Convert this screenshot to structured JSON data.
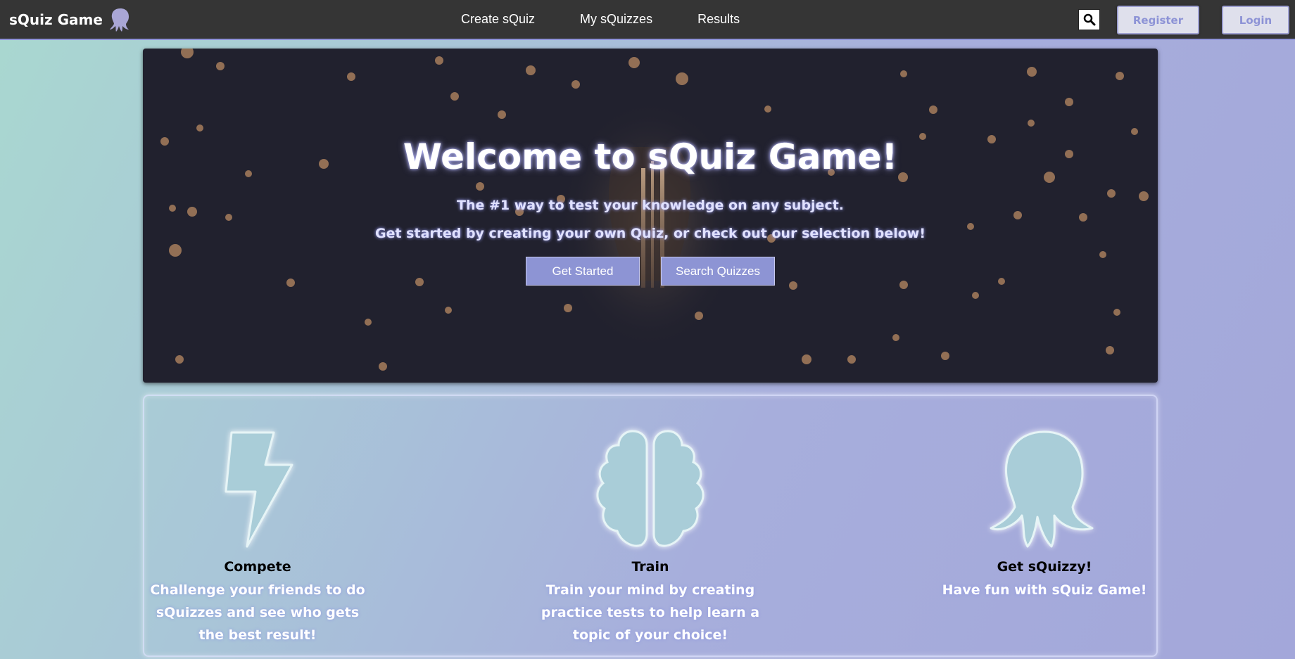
{
  "navbar": {
    "brand": "sQuiz Game",
    "links": [
      "Create sQuiz",
      "My sQuizzes",
      "Results"
    ],
    "register": "Register",
    "login": "Login"
  },
  "hero": {
    "title": "Welcome to sQuiz Game!",
    "subtitle1": "The #1 way to test your knowledge on any subject.",
    "subtitle2": "Get started by creating your own Quiz, or check out our selection below!",
    "get_started": "Get Started",
    "search_quizzes": "Search Quizzes"
  },
  "features": [
    {
      "icon": "lightning-icon",
      "title": "Compete",
      "desc": "Challenge your friends to do sQuizzes and see who gets the best result!"
    },
    {
      "icon": "brain-icon",
      "title": "Train",
      "desc": "Train your mind by creating practice tests to help learn a topic of your choice!"
    },
    {
      "icon": "octopus-icon",
      "title": "Get sQuizzy!",
      "desc": "Have fun with sQuiz Game!"
    }
  ],
  "colors": {
    "navbar": "#353535",
    "accent": "#8d94d4",
    "hero_bg": "#21212e",
    "feature_icon": "#a9cdd8"
  }
}
